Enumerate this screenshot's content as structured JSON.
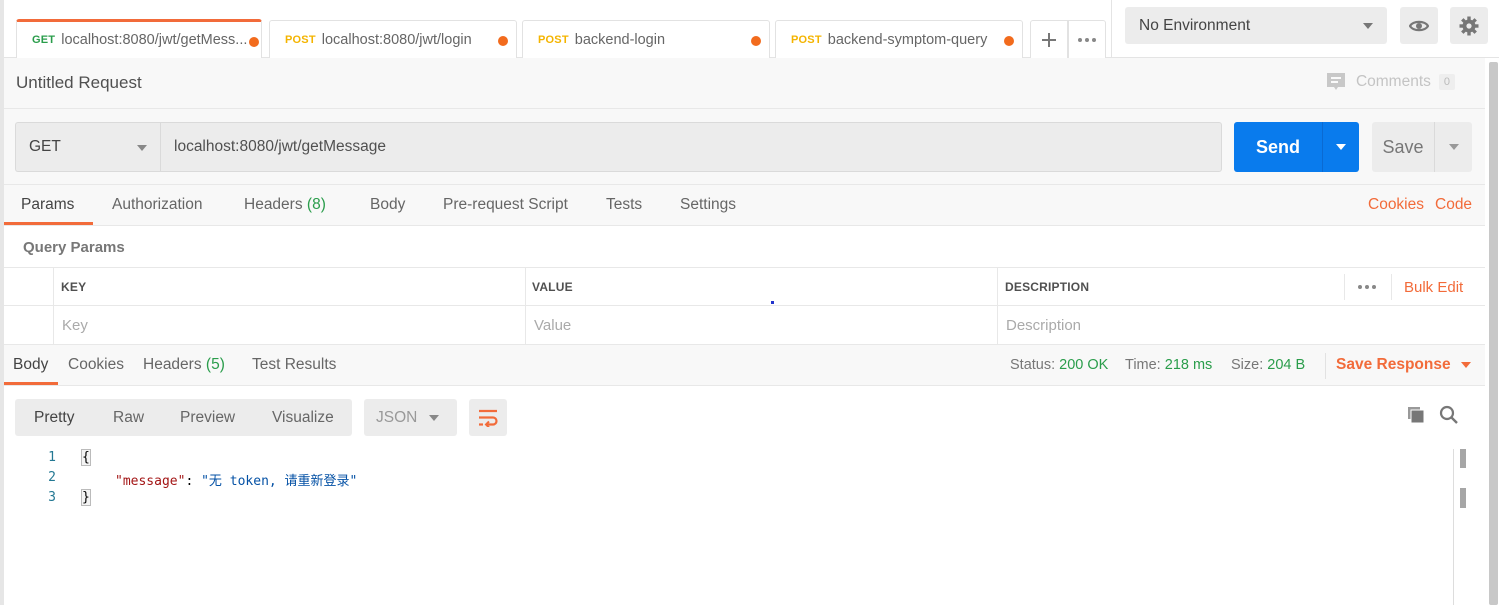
{
  "tabs": [
    {
      "method": "GET",
      "title": "localhost:8080/jwt/getMess...",
      "active": true,
      "unsaved": true
    },
    {
      "method": "POST",
      "title": "localhost:8080/jwt/login",
      "active": false,
      "unsaved": true
    },
    {
      "method": "POST",
      "title": "backend-login",
      "active": false,
      "unsaved": true
    },
    {
      "method": "POST",
      "title": "backend-symptom-query",
      "active": false,
      "unsaved": true
    }
  ],
  "tab_actions": {
    "new_tab_icon": "plus-icon",
    "more_icon": "more-horizontal-icon"
  },
  "environment": {
    "selected": "No Environment",
    "eye_icon": "eye-icon",
    "settings_icon": "gear-icon"
  },
  "request": {
    "title": "Untitled Request",
    "comments_label": "Comments",
    "comments_count": "0",
    "method": "GET",
    "url": "localhost:8080/jwt/getMessage",
    "send_label": "Send",
    "save_label": "Save"
  },
  "request_tabs": [
    {
      "label": "Params",
      "count": "",
      "active": true
    },
    {
      "label": "Authorization",
      "count": ""
    },
    {
      "label": "Headers",
      "count": "(8)"
    },
    {
      "label": "Body",
      "count": ""
    },
    {
      "label": "Pre-request Script",
      "count": ""
    },
    {
      "label": "Tests",
      "count": ""
    },
    {
      "label": "Settings",
      "count": ""
    }
  ],
  "request_links": {
    "cookies": "Cookies",
    "code": "Code"
  },
  "query_params": {
    "title": "Query Params",
    "columns": [
      "KEY",
      "VALUE",
      "DESCRIPTION"
    ],
    "bulk_edit": "Bulk Edit",
    "placeholders": {
      "key": "Key",
      "value": "Value",
      "description": "Description"
    }
  },
  "response_tabs": [
    {
      "label": "Body",
      "count": "",
      "active": true
    },
    {
      "label": "Cookies",
      "count": ""
    },
    {
      "label": "Headers",
      "count": "(5)"
    },
    {
      "label": "Test Results",
      "count": ""
    }
  ],
  "response_status": {
    "status_label": "Status:",
    "status_value": "200 OK",
    "time_label": "Time:",
    "time_value": "218 ms",
    "size_label": "Size:",
    "size_value": "204 B",
    "save_response": "Save Response"
  },
  "colors": {
    "accent": "#f26b3a",
    "send": "#097bed",
    "success": "#2a9d4b",
    "post": "#f4b400"
  },
  "view_modes": [
    "Pretty",
    "Raw",
    "Preview",
    "Visualize"
  ],
  "active_view": "Pretty",
  "format": "JSON",
  "response_body": {
    "lines": [
      {
        "n": "1",
        "open": "{"
      },
      {
        "n": "2",
        "key": "\"message\"",
        "sep": ": ",
        "value": "\"无 token, 请重新登录\""
      },
      {
        "n": "3",
        "close": "}"
      }
    ]
  }
}
